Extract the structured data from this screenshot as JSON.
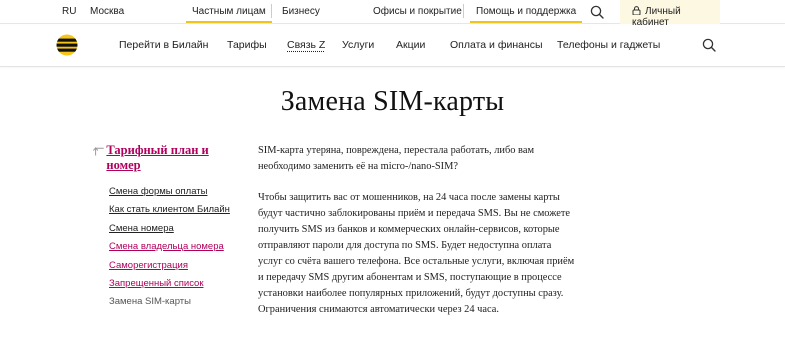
{
  "topbar": {
    "lang": "RU",
    "city": "Москва",
    "tabs": [
      {
        "label": "Частным лицам",
        "active": true
      },
      {
        "label": "Бизнесу",
        "active": false
      },
      {
        "label": "Офисы и покрытие",
        "active": false
      },
      {
        "label": "Помощь и поддержка",
        "active": true
      }
    ],
    "cabinet_label": "Личный кабинет"
  },
  "mainnav": {
    "items": [
      "Перейти в Билайн",
      "Тарифы",
      "Связь Z",
      "Услуги",
      "Акции",
      "Оплата и финансы",
      "Телефоны и гаджеты"
    ]
  },
  "page": {
    "title": "Замена SIM-карты"
  },
  "sidebar": {
    "category": "Тарифный план и номер",
    "items": [
      "Смена формы оплаты",
      "Как стать клиентом Билайн",
      "Смена номера",
      "Смена владельца номера",
      "Саморегистрация",
      "Запрещенный список",
      "Замена SIM-карты"
    ]
  },
  "content": {
    "intro": "SIM-карта утеряна, повреждена, перестала работать, либо вам необходимо заменить её на micro-/nano-SIM?",
    "paragraph": "Чтобы защитить вас от мошенников, на 24 часа после замены карты будут частично заблокированы приём и передача SMS. Вы не сможете получить SMS из банков и коммерческих онлайн-сервисов, которые отправляют пароли для доступа по SMS. Будет недоступна оплата услуг со счёта вашего телефона. Все остальные услуги, включая приём и передачу SMS другим абонентам и SMS, поступающие в процессе установки наиболее популярных приложений, будут доступны сразу. Ограничения снимаются автоматически через 24 часа."
  },
  "colors": {
    "accent_yellow": "#f0c418",
    "link_pink": "#b0005d",
    "cabinet_bg": "#fdf8e1"
  },
  "icons": {
    "top_search": "search-icon",
    "main_search": "search-icon",
    "cabinet": "lock-icon",
    "logo": "beeline-logo",
    "back": "back-arrow-icon"
  }
}
